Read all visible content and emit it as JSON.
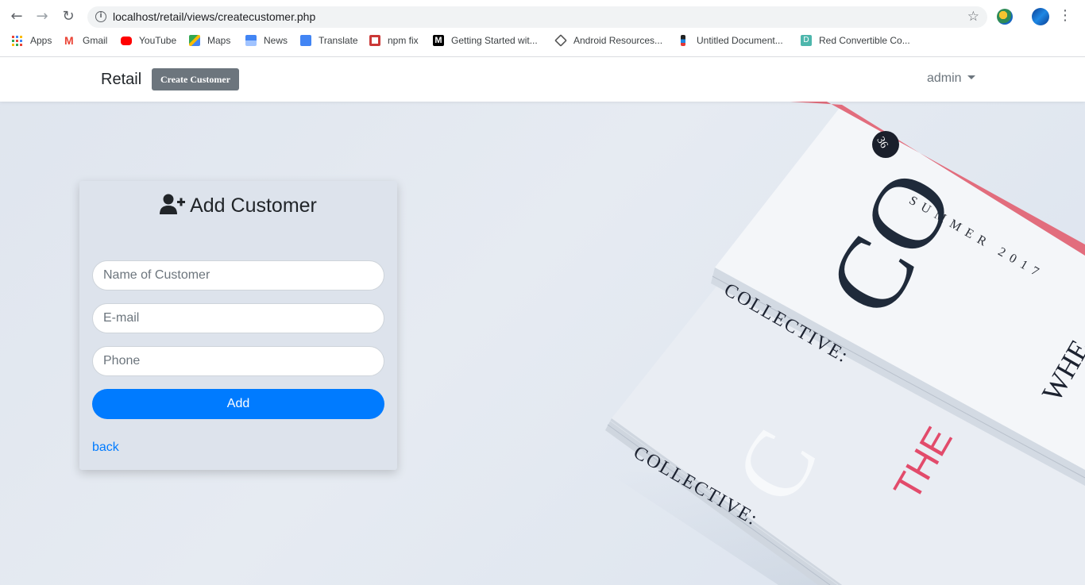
{
  "browser": {
    "url": "localhost/retail/views/createcustomer.php",
    "bookmarks": [
      {
        "label": "Apps",
        "icon": "apps-grid-icon"
      },
      {
        "label": "Gmail",
        "icon": "gmail-icon"
      },
      {
        "label": "YouTube",
        "icon": "youtube-icon"
      },
      {
        "label": "Maps",
        "icon": "maps-icon"
      },
      {
        "label": "News",
        "icon": "news-icon"
      },
      {
        "label": "Translate",
        "icon": "translate-icon"
      },
      {
        "label": "npm fix",
        "icon": "npm-icon"
      },
      {
        "label": "Getting Started wit...",
        "icon": "medium-icon"
      },
      {
        "label": "Android Resources...",
        "icon": "android-resources-icon"
      },
      {
        "label": "Untitled Document...",
        "icon": "document-icon"
      },
      {
        "label": "Red Convertible Co...",
        "icon": "d-icon"
      }
    ]
  },
  "navbar": {
    "brand": "Retail",
    "create_button": "Create Customer",
    "user": "admin"
  },
  "form": {
    "title": "Add Customer",
    "name_placeholder": "Name of Customer",
    "email_placeholder": "E-mail",
    "phone_placeholder": "Phone",
    "add_label": "Add",
    "back_label": "back"
  },
  "background": {
    "mag_number": "36",
    "mag_issue": "SUMMER 2017",
    "mag_brand": "COLLECTIVE:",
    "mag_letters_top": "CO",
    "mag_letters_bottom": "C",
    "mag_red_word": "THE",
    "mag_side_text": "WHE"
  },
  "colors": {
    "primary": "#007bff",
    "secondary": "#6c757d"
  }
}
